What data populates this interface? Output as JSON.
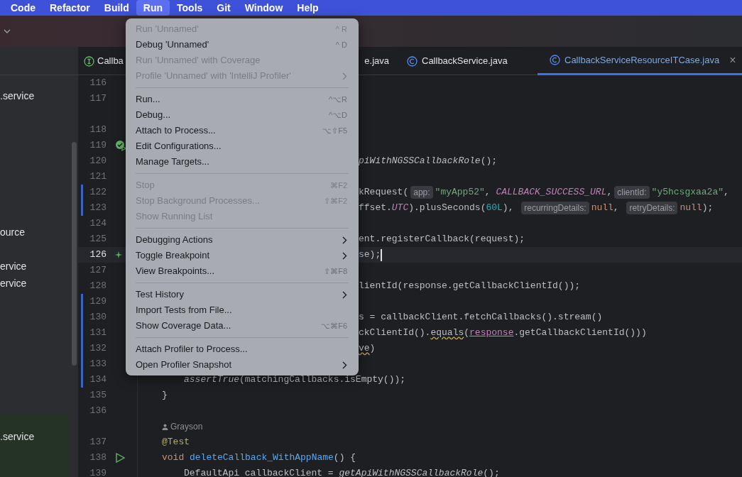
{
  "menubar": [
    {
      "label": "Code",
      "selected": false
    },
    {
      "label": "Refactor",
      "selected": false
    },
    {
      "label": "Build",
      "selected": false
    },
    {
      "label": "Run",
      "selected": true
    },
    {
      "label": "Tools",
      "selected": false
    },
    {
      "label": "Git",
      "selected": false
    },
    {
      "label": "Window",
      "selected": false
    },
    {
      "label": "Help",
      "selected": false
    }
  ],
  "project_tree": [
    {
      "label": ".service",
      "selected": false
    },
    {
      "label": "ource",
      "selected": false
    },
    {
      "label": "ervice",
      "selected": false
    },
    {
      "label": "ervice",
      "selected": false
    },
    {
      "label": ".service",
      "selected": true
    }
  ],
  "tabs": [
    {
      "label": "Callba",
      "kind": "interface",
      "selected": false
    },
    {
      "label": "e.java",
      "kind": "fragment",
      "selected": false
    },
    {
      "label": "CallbackService.java",
      "kind": "class",
      "selected": false
    },
    {
      "label": "CallbackServiceResourceITCase.java",
      "kind": "class",
      "selected": true,
      "close": "×"
    }
  ],
  "editor_lines": [
    {
      "kind": "code",
      "number": "116"
    },
    {
      "kind": "code",
      "number": "117"
    },
    {
      "kind": "hint"
    },
    {
      "kind": "code",
      "number": "118"
    },
    {
      "kind": "code",
      "number": "119",
      "gutter_icon": {
        "kind": "test_passed"
      }
    },
    {
      "kind": "partial",
      "number": "120",
      "tokens": [
        {
          "text": "piWithNGSSCallbackRole",
          "kind": "italic"
        },
        {
          "text": "();",
          "kind": "plain"
        }
      ]
    },
    {
      "kind": "code",
      "number": "121"
    },
    {
      "kind": "partial",
      "number": "122",
      "changed": true,
      "tokens": [
        {
          "text": "kRequest(",
          "kind": "plain"
        },
        {
          "text": "app:",
          "kind": "inlay"
        },
        {
          "text": "\"myApp52\"",
          "kind": "string"
        },
        {
          "text": ", ",
          "kind": "plain"
        },
        {
          "text": "CALLBACK_SUCCESS_URL",
          "kind": "constant"
        },
        {
          "text": ",",
          "kind": "plain"
        },
        {
          "text": "clientId:",
          "kind": "inlay"
        },
        {
          "text": "\"y5hcsgxaa2a\"",
          "kind": "string"
        },
        {
          "text": ", ",
          "kind": "plain"
        }
      ]
    },
    {
      "kind": "partial",
      "number": "123",
      "changed": true,
      "tokens": [
        {
          "text": "ffset.",
          "kind": "plain"
        },
        {
          "text": "UTC",
          "kind": "constant"
        },
        {
          "text": ").plusSeconds(",
          "kind": "plain"
        },
        {
          "text": "60L",
          "kind": "number"
        },
        {
          "text": "), ",
          "kind": "plain"
        },
        {
          "text": "recurringDetails:",
          "kind": "inlay"
        },
        {
          "text": "null",
          "kind": "keyword"
        },
        {
          "text": ", ",
          "kind": "plain"
        },
        {
          "text": "retryDetails:",
          "kind": "inlay"
        },
        {
          "text": "null",
          "kind": "keyword"
        },
        {
          "text": ");",
          "kind": "plain"
        }
      ]
    },
    {
      "kind": "code",
      "number": "124"
    },
    {
      "kind": "partial",
      "number": "125",
      "tokens": [
        {
          "text": "ent.registerCallback(request);",
          "kind": "plain"
        }
      ]
    },
    {
      "kind": "partial",
      "number": "126",
      "current": true,
      "gutter_icon": {
        "kind": "sparkle"
      },
      "tokens": [
        {
          "text": "se);",
          "kind": "plain"
        }
      ]
    },
    {
      "kind": "code",
      "number": "127"
    },
    {
      "kind": "partial",
      "number": "128",
      "tokens": [
        {
          "text": "lientId(response.getCallbackClientId());",
          "kind": "plain"
        }
      ]
    },
    {
      "kind": "code",
      "number": "129",
      "changed": true
    },
    {
      "kind": "partial",
      "number": "130",
      "changed": true,
      "tokens": [
        {
          "text": "s = callbackClient.fetchCallbacks().stream()",
          "kind": "plain"
        }
      ]
    },
    {
      "kind": "partial",
      "number": "131",
      "changed": true,
      "tokens": [
        {
          "text": "ckClientId().",
          "kind": "plain"
        },
        {
          "text": "equals",
          "kind": "warning"
        },
        {
          "text": "(",
          "kind": "plain"
        },
        {
          "text": "response",
          "kind": "param_ref"
        },
        {
          "text": ".getCallbackClientId()))",
          "kind": "plain"
        }
      ]
    },
    {
      "kind": "partial",
      "number": "132",
      "changed": true,
      "tokens": [
        {
          "text": "ve",
          "kind": "warning"
        },
        {
          "text": ")",
          "kind": "plain"
        }
      ]
    },
    {
      "kind": "code",
      "number": "133",
      "changed": true
    },
    {
      "kind": "indented",
      "number": "134",
      "changed": true,
      "tokens": [
        {
          "text": "assertTrue",
          "kind": "italic"
        },
        {
          "text": "(matchingCallbacks.isEmpty());",
          "kind": "plain"
        }
      ]
    },
    {
      "kind": "code",
      "number": "135",
      "tokens": [
        {
          "text": "}",
          "kind": "plain"
        }
      ]
    },
    {
      "kind": "code",
      "number": "136"
    },
    {
      "kind": "hint",
      "text": "Grayson"
    },
    {
      "kind": "code",
      "number": "137",
      "tokens": [
        {
          "text": "@Test",
          "kind": "annotation"
        }
      ]
    },
    {
      "kind": "code",
      "number": "138",
      "gutter_icon": {
        "kind": "run"
      },
      "tokens": [
        {
          "text": "void ",
          "kind": "keyword"
        },
        {
          "text": "deleteCallback_WithAppName",
          "kind": "method"
        },
        {
          "text": "() {",
          "kind": "plain"
        }
      ]
    },
    {
      "kind": "indented",
      "number": "139",
      "tokens": [
        {
          "text": "DefaultApi callbackClient = ",
          "kind": "plain"
        },
        {
          "text": "getApiWithNGSSCallbackRole",
          "kind": "italic"
        },
        {
          "text": "();",
          "kind": "plain"
        }
      ]
    }
  ],
  "run_menu": [
    {
      "kind": "item",
      "label": "Run 'Unnamed'",
      "shortcut": "^ R",
      "disabled": true
    },
    {
      "kind": "item",
      "label": "Debug 'Unnamed'",
      "shortcut": "^ D",
      "disabled": false
    },
    {
      "kind": "item",
      "label": "Run 'Unnamed' with Coverage",
      "disabled": true
    },
    {
      "kind": "item",
      "label": "Profile 'Unnamed' with 'IntelliJ Profiler'",
      "disabled": true,
      "submenu": true
    },
    {
      "kind": "separator"
    },
    {
      "kind": "item",
      "label": "Run...",
      "shortcut": "^⌥R",
      "disabled": false
    },
    {
      "kind": "item",
      "label": "Debug...",
      "shortcut": "^⌥D",
      "disabled": false
    },
    {
      "kind": "item",
      "label": "Attach to Process...",
      "shortcut": "⌥⇧F5",
      "disabled": false
    },
    {
      "kind": "item",
      "label": "Edit Configurations...",
      "disabled": false
    },
    {
      "kind": "item",
      "label": "Manage Targets...",
      "disabled": false
    },
    {
      "kind": "separator"
    },
    {
      "kind": "item",
      "label": "Stop",
      "shortcut": "⌘F2",
      "disabled": true
    },
    {
      "kind": "item",
      "label": "Stop Background Processes...",
      "shortcut": "⇧⌘F2",
      "disabled": true
    },
    {
      "kind": "item",
      "label": "Show Running List",
      "disabled": true
    },
    {
      "kind": "separator"
    },
    {
      "kind": "item",
      "label": "Debugging Actions",
      "disabled": false,
      "submenu": true
    },
    {
      "kind": "item",
      "label": "Toggle Breakpoint",
      "disabled": false,
      "submenu": true
    },
    {
      "kind": "item",
      "label": "View Breakpoints...",
      "shortcut": "⇧⌘F8",
      "disabled": false
    },
    {
      "kind": "separator"
    },
    {
      "kind": "item",
      "label": "Test History",
      "disabled": false,
      "submenu": true
    },
    {
      "kind": "item",
      "label": "Import Tests from File...",
      "disabled": false
    },
    {
      "kind": "item",
      "label": "Show Coverage Data...",
      "shortcut": "⌥⌘F6",
      "disabled": false
    },
    {
      "kind": "separator"
    },
    {
      "kind": "item",
      "label": "Attach Profiler to Process...",
      "disabled": false
    },
    {
      "kind": "item",
      "label": "Open Profiler Snapshot",
      "disabled": false,
      "submenu": true
    }
  ]
}
